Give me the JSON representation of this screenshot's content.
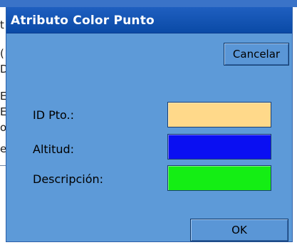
{
  "dialog": {
    "title": "Atributo Color Punto",
    "cancel_label": "Cancelar",
    "ok_label": "OK"
  },
  "background_fragments": [
    "t",
    "(",
    "D",
    "E",
    "E",
    "o",
    "e"
  ],
  "attributes": [
    {
      "label": "ID Pto.:",
      "color": "#ffd98a"
    },
    {
      "label": "Altitud:",
      "color": "#0a0ff2"
    },
    {
      "label": "Descripción:",
      "color": "#14ee14"
    }
  ]
}
